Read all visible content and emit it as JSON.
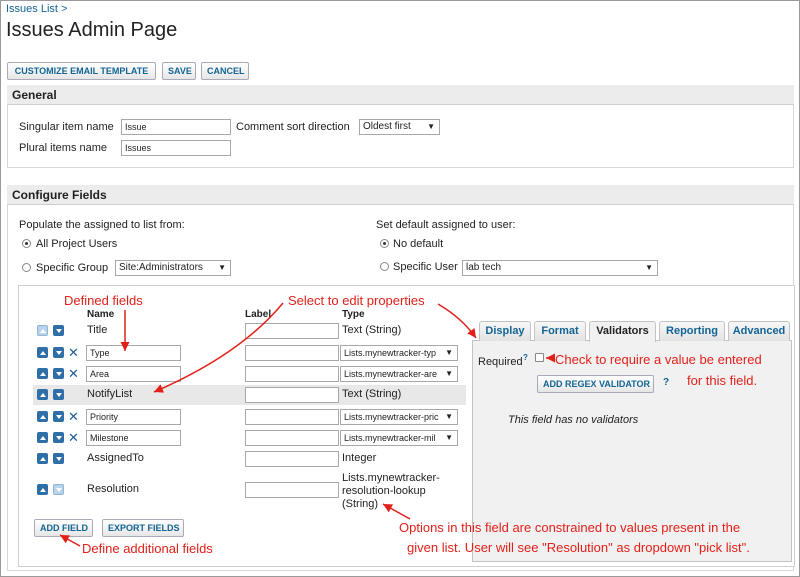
{
  "breadcrumb": {
    "link": "Issues List",
    "sep": ">"
  },
  "page_title": "Issues Admin Page",
  "toolbar": {
    "customize": "CUSTOMIZE EMAIL TEMPLATE",
    "save": "SAVE",
    "cancel": "CANCEL"
  },
  "general": {
    "heading": "General",
    "singular_label": "Singular item name",
    "singular_value": "Issue",
    "plural_label": "Plural items name",
    "plural_value": "Issues",
    "sort_label": "Comment sort direction",
    "sort_value": "Oldest first"
  },
  "configure": {
    "heading": "Configure Fields",
    "populate_label": "Populate the assigned to list from:",
    "all_users": "All Project Users",
    "specific_group": "Specific Group",
    "group_value": "Site:Administrators",
    "default_label": "Set default assigned to user:",
    "no_default": "No default",
    "specific_user": "Specific User",
    "user_value": "lab tech"
  },
  "columns": {
    "name": "Name",
    "label": "Label",
    "type": "Type"
  },
  "fields": [
    {
      "name": "Title",
      "type": "Text (String)"
    },
    {
      "name": "Type",
      "type": "Lists.mynewtracker-typ"
    },
    {
      "name": "Area",
      "type": "Lists.mynewtracker-are"
    },
    {
      "name": "NotifyList",
      "type": "Text (String)"
    },
    {
      "name": "Priority",
      "type": "Lists.mynewtracker-pric"
    },
    {
      "name": "Milestone",
      "type": "Lists.mynewtracker-mil"
    },
    {
      "name": "AssignedTo",
      "type": "Integer"
    },
    {
      "name": "Resolution",
      "type_line1": "Lists.mynewtracker-",
      "type_line2": "resolution-lookup",
      "type_line3": "(String)"
    }
  ],
  "buttons": {
    "add_field": "ADD FIELD",
    "export_fields": "EXPORT FIELDS",
    "add_regex": "ADD REGEX VALIDATOR",
    "help": "?"
  },
  "tabs": [
    "Display",
    "Format",
    "Validators",
    "Reporting",
    "Advanced"
  ],
  "validators": {
    "required_label": "Required",
    "sup": "?",
    "empty": "This field has no validators"
  },
  "annotations": {
    "defined_fields": "Defined fields",
    "select_edit": "Select to edit properties",
    "check_required_1": "Check to require a value be entered",
    "check_required_2": "for this field.",
    "define_additional": "Define additional fields",
    "options_1": "Options in this field are constrained to values present in the",
    "options_2": "given list. User will see \"Resolution\" as dropdown \"pick list\"."
  },
  "colors": {
    "link": "#126495",
    "annotation": "#e2201a",
    "section_bg": "#ececec",
    "arrow_icon": "#2f6fa7"
  }
}
